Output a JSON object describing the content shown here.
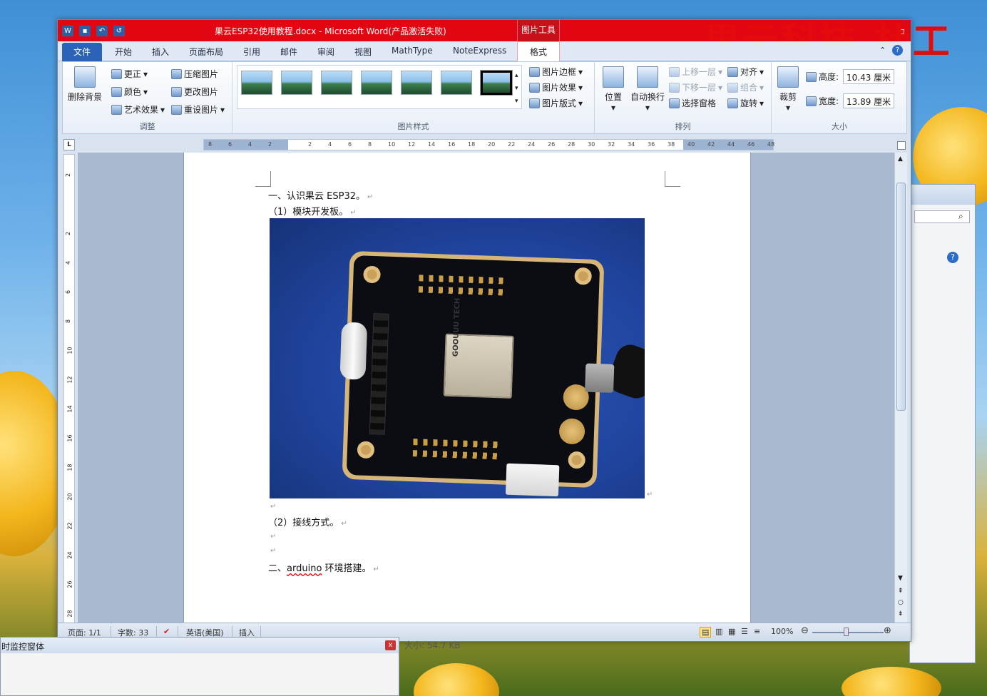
{
  "window": {
    "title": "果云ESP32使用教程.docx - Microsoft Word(产品激活失败)",
    "context_tab": "图片工具",
    "watermark": "果云科技-杜工"
  },
  "qat": {
    "word": "W",
    "save": "▪",
    "undo": "↶",
    "redo": "↺"
  },
  "tabs": [
    "文件",
    "开始",
    "插入",
    "页面布局",
    "引用",
    "邮件",
    "审阅",
    "视图",
    "MathType",
    "NoteExpress",
    "格式"
  ],
  "ribbon": {
    "adjust": {
      "remove_bg": "删除背景",
      "corrections": "更正",
      "color": "颜色",
      "artistic": "艺术效果",
      "compress": "压缩图片",
      "change": "更改图片",
      "reset": "重设图片",
      "label": "调整"
    },
    "styles": {
      "border": "图片边框",
      "effects": "图片效果",
      "layout": "图片版式",
      "label": "图片样式"
    },
    "arrange": {
      "position": "位置",
      "wrap": "自动换行",
      "forward": "上移一层",
      "backward": "下移一层",
      "pane": "选择窗格",
      "align": "对齐",
      "group": "组合",
      "rotate": "旋转",
      "label": "排列"
    },
    "size": {
      "crop": "裁剪",
      "height_label": "高度:",
      "height": "10.43 厘米",
      "width_label": "宽度:",
      "width": "13.89 厘米",
      "label": "大小"
    }
  },
  "ruler": [
    "8",
    "6",
    "4",
    "2",
    "",
    "2",
    "4",
    "6",
    "8",
    "10",
    "12",
    "14",
    "16",
    "18",
    "20",
    "22",
    "24",
    "26",
    "28",
    "30",
    "32",
    "34",
    "36",
    "38",
    "40",
    "42",
    "44",
    "46",
    "48"
  ],
  "vruler": [
    "2",
    "",
    "2",
    "4",
    "6",
    "8",
    "10",
    "12",
    "14",
    "16",
    "18",
    "20",
    "22",
    "24",
    "26",
    "28"
  ],
  "document": {
    "l1": "一、认识果云 ESP32。",
    "l2": "（1）模块开发板。",
    "l3": "（2）接线方式。",
    "l4a": "二、",
    "l4b": "arduino",
    "l4c": " 环境搭建。",
    "para": "↵"
  },
  "photo": {
    "module_label": "GOOUUU TECH"
  },
  "status": {
    "page": "页面: 1/1",
    "words": "字数: 33",
    "lang": "英语(美国)",
    "mode": "插入",
    "zoom": "100%"
  },
  "monitor": {
    "title": "时监控窗体",
    "close": "x"
  },
  "bg": {
    "size": "大小: 54.7 KB"
  }
}
